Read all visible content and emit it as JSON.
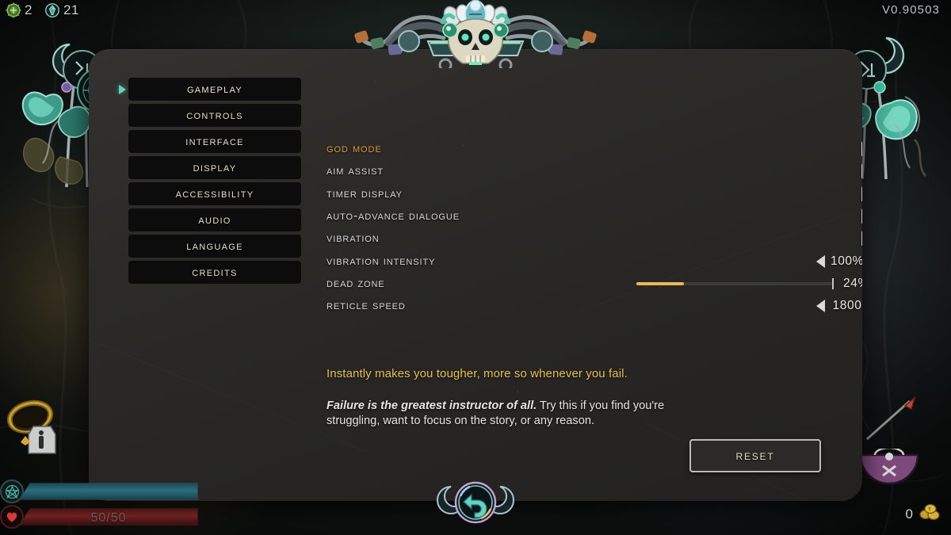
{
  "hud": {
    "currencies": [
      {
        "icon": "darkness-orb-icon",
        "value": "2",
        "color": "#6fae4a"
      },
      {
        "icon": "gem-icon",
        "value": "21",
        "color": "#4aa89a"
      }
    ],
    "version": "V0.90503",
    "mana_bar": {
      "icon": "star-mana-icon",
      "label": ""
    },
    "health_bar": {
      "icon": "heart-icon",
      "label": "50/50"
    },
    "gold": {
      "icon": "gold-coins-icon",
      "value": "0"
    }
  },
  "ornaments": {
    "skull": "skull-crown-ornament",
    "left": "left-floral-ornament",
    "right": "right-floral-ornament",
    "back_button": "back-arrow-button",
    "ring_item": "ring-item-icon",
    "bag_item": "bag-item-icon",
    "spear_item": "spear-item-icon"
  },
  "sidebar": {
    "items": [
      {
        "label": "Gameplay",
        "selected": true
      },
      {
        "label": "Controls",
        "selected": false
      },
      {
        "label": "Interface",
        "selected": false
      },
      {
        "label": "Display",
        "selected": false
      },
      {
        "label": "Accessibility",
        "selected": false
      },
      {
        "label": "Audio",
        "selected": false
      },
      {
        "label": "Language",
        "selected": false
      },
      {
        "label": "Credits",
        "selected": false
      }
    ]
  },
  "settings": {
    "rows": [
      {
        "label": "God Mode",
        "type": "checkbox",
        "checked": true,
        "selected": true,
        "highlight": true
      },
      {
        "label": "Aim Assist",
        "type": "checkbox",
        "checked": true,
        "selected": false,
        "highlight": false
      },
      {
        "label": "Timer Display",
        "type": "checkbox",
        "checked": false,
        "selected": false,
        "highlight": false
      },
      {
        "label": "Auto-Advance Dialogue",
        "type": "checkbox",
        "checked": false,
        "selected": false,
        "highlight": false
      },
      {
        "label": "Vibration",
        "type": "checkbox",
        "checked": true,
        "selected": false,
        "highlight": false
      },
      {
        "label": "Vibration Intensity",
        "type": "stepper",
        "value": "100%",
        "selected": false,
        "left_enabled": true,
        "right_enabled": false
      },
      {
        "label": "Dead Zone",
        "type": "slider",
        "value": "24%",
        "percent": 24,
        "selected": false
      },
      {
        "label": "Reticle Speed",
        "type": "stepper",
        "value": "1800",
        "selected": false,
        "left_enabled": true,
        "right_enabled": false
      }
    ]
  },
  "description": {
    "headline": "Instantly makes you tougher, more so whenever you fail.",
    "body_bold": "Failure is the greatest instructor of all.",
    "body_rest": " Try this if you find you're struggling, want to focus on the story, or any reason."
  },
  "reset": {
    "label": "Reset"
  },
  "colors": {
    "accent_gold": "#e09d3a",
    "desc_yellow": "#e8c24a",
    "slider_fill": "#e7b855",
    "nav_text": "#e8dfc8",
    "teal": "#5fd4b4"
  }
}
